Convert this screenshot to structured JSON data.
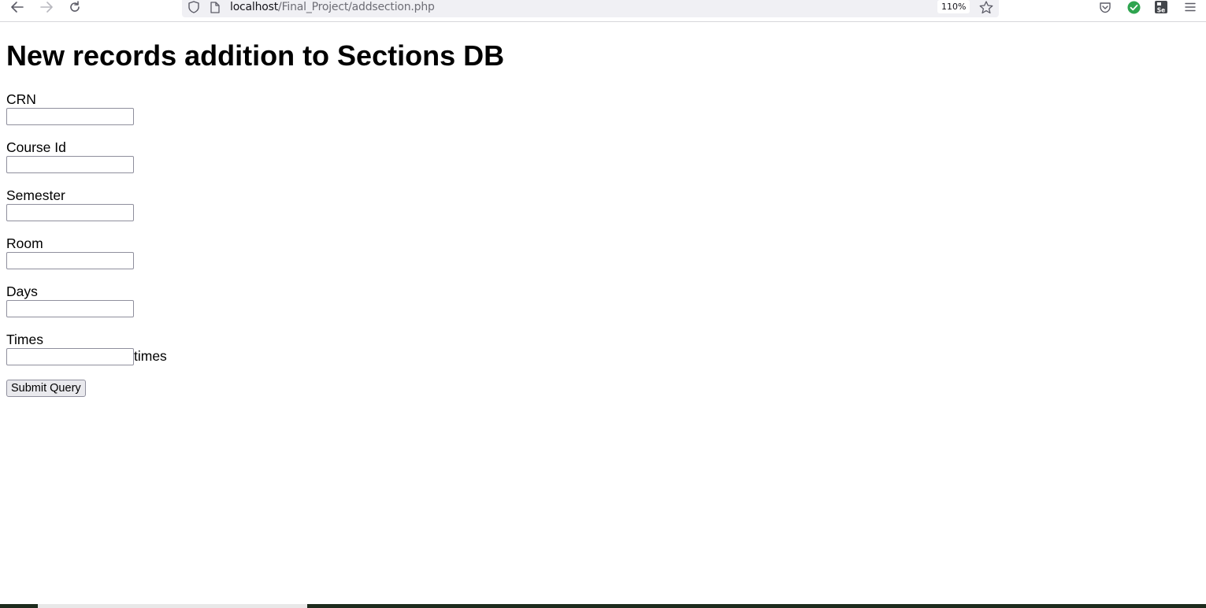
{
  "browser": {
    "url_host": "localhost",
    "url_path": "/Final_Project/addsection.php",
    "zoom": "110%",
    "icons": {
      "back": "back-arrow-icon",
      "forward": "forward-arrow-icon",
      "reload": "reload-icon",
      "shield": "shield-icon",
      "page": "page-icon",
      "bookmark": "star-icon",
      "pocket": "pocket-icon",
      "extension_check": "check-circle-icon",
      "extension_se": "selenium-icon",
      "menu": "hamburger-menu-icon"
    },
    "extension_se_label": "Se"
  },
  "page": {
    "title": "New records addition to Sections DB",
    "fields": [
      {
        "label": "CRN",
        "value": ""
      },
      {
        "label": "Course Id",
        "value": ""
      },
      {
        "label": "Semester",
        "value": ""
      },
      {
        "label": "Room",
        "value": ""
      },
      {
        "label": "Days",
        "value": ""
      },
      {
        "label": "Times",
        "value": "",
        "suffix": "times"
      }
    ],
    "submit_label": "Submit Query"
  }
}
